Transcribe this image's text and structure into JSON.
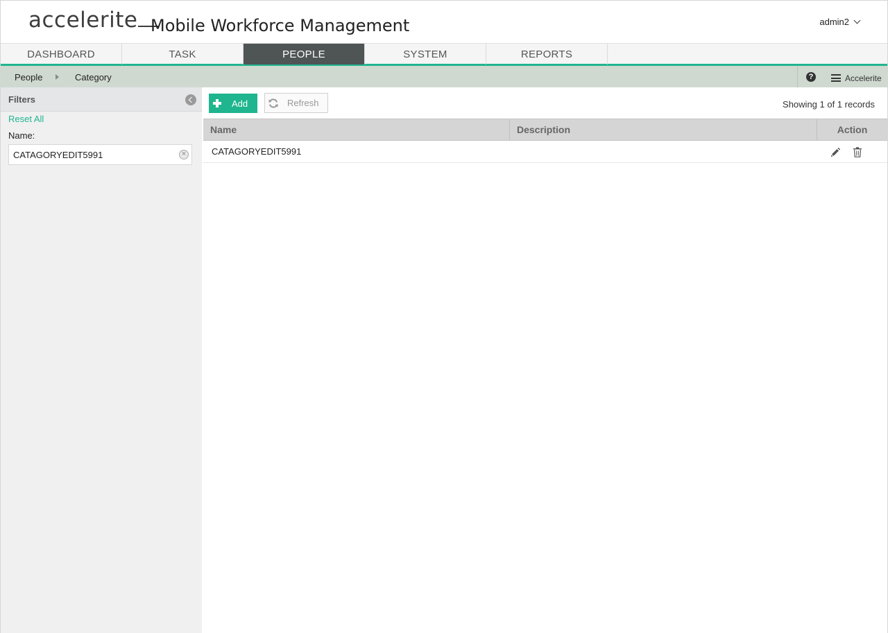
{
  "header": {
    "logo_text": "accelerite",
    "app_title": "Mobile Workforce Management",
    "user": "admin2"
  },
  "nav": {
    "tabs": [
      {
        "label": "DASHBOARD",
        "active": false
      },
      {
        "label": "TASK",
        "active": false
      },
      {
        "label": "PEOPLE",
        "active": true
      },
      {
        "label": "SYSTEM",
        "active": false
      },
      {
        "label": "REPORTS",
        "active": false
      }
    ]
  },
  "breadcrumb": {
    "items": [
      "People",
      "Category"
    ],
    "org": "Accelerite"
  },
  "filters": {
    "title": "Filters",
    "reset_label": "Reset All",
    "name_label": "Name:",
    "name_value": "CATAGORYEDIT5991"
  },
  "toolbar": {
    "add_label": "Add",
    "refresh_label": "Refresh",
    "records_info": "Showing 1 of 1 records"
  },
  "grid": {
    "columns": [
      "Name",
      "Description",
      "Action"
    ],
    "rows": [
      {
        "name": "CATAGORYEDIT5991",
        "description": ""
      }
    ]
  },
  "colors": {
    "accent": "#1fb58f",
    "nav_active_bg": "#4f5455",
    "breadcrumb_bg": "#cfd9cf"
  }
}
